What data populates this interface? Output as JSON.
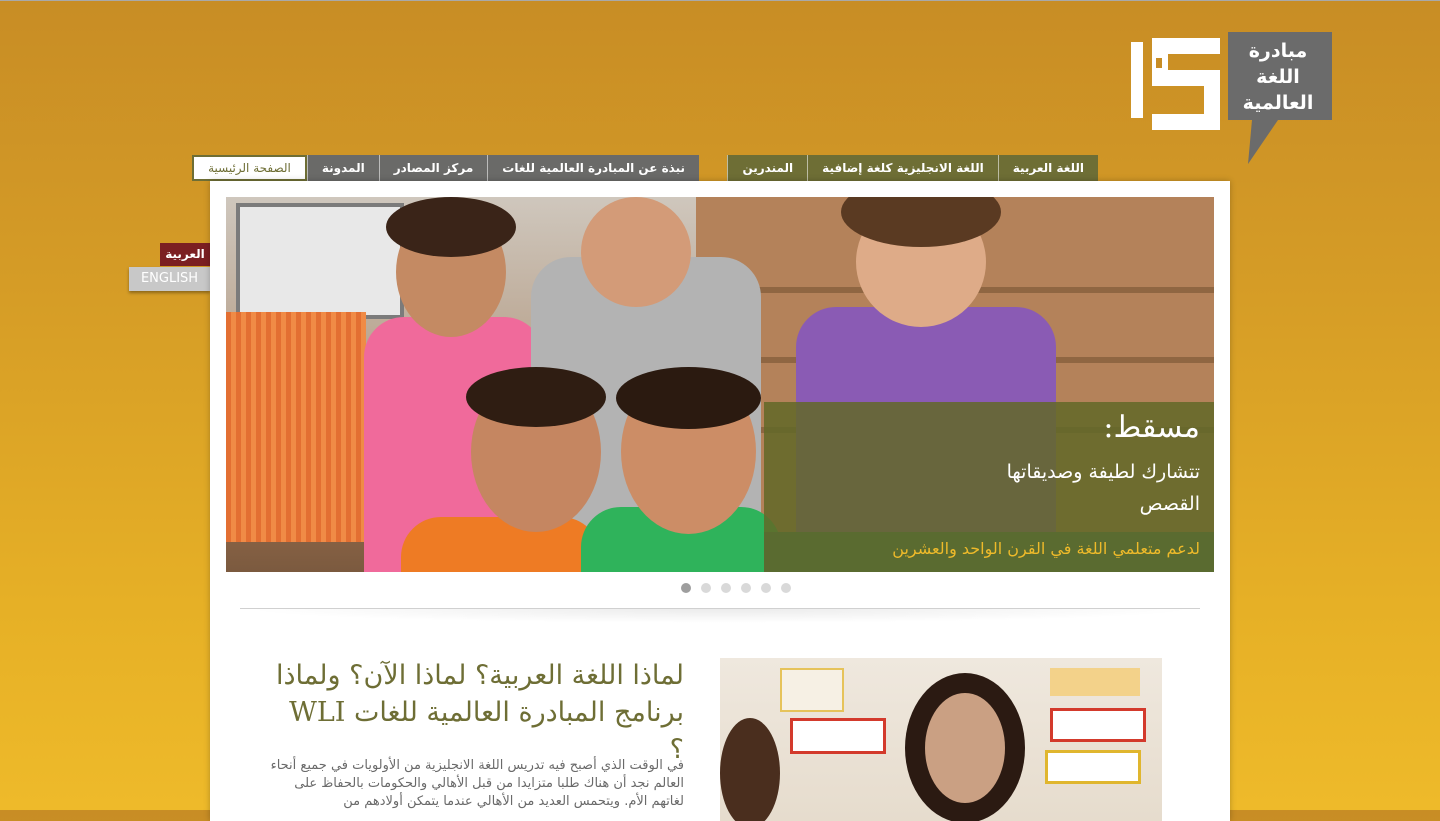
{
  "logo": {
    "line1": "مبادرة",
    "line2": "اللغة",
    "line3": "العالمية"
  },
  "nav": {
    "left": [
      "الصفحة الرئيسية",
      "المدونة",
      "مركز المصادر",
      "نبذة عن المبادرة العالمية للغات"
    ],
    "right": [
      "المندرين",
      "اللغة الانجليزية كلغة إضافية",
      "اللغة العربية"
    ]
  },
  "lang": {
    "arabic": "العربية",
    "english": "ENGLISH"
  },
  "hero": {
    "title": "مسقط:",
    "text": "تتشارك لطيفة وصديقاتها القصص",
    "tagline": "لدعم متعلمي اللغة في القرن الواحد والعشرين"
  },
  "slider": {
    "count": 6,
    "active": 1
  },
  "section": {
    "title": "لماذا اللغة العربية؟ لماذا الآن؟ ولماذا برنامج المبادرة العالمية للغات WLI ؟",
    "body": "في الوقت الذي أصبح فيه تدريس اللغة الانجليزية من الأولويات في جميع أنحاء العالم نجد أن هناك طلبا متزايدا من قبل الأهالي والحكومات بالحفاظ على لغاتهم الأم. ويتحمس العديد من الأهالي عندما يتمكن أولادهم من"
  },
  "colors": {
    "olive": "#6e6e35",
    "grey": "#6a6a68",
    "maroon": "#7b1f22",
    "gold": "#eeba2a"
  }
}
